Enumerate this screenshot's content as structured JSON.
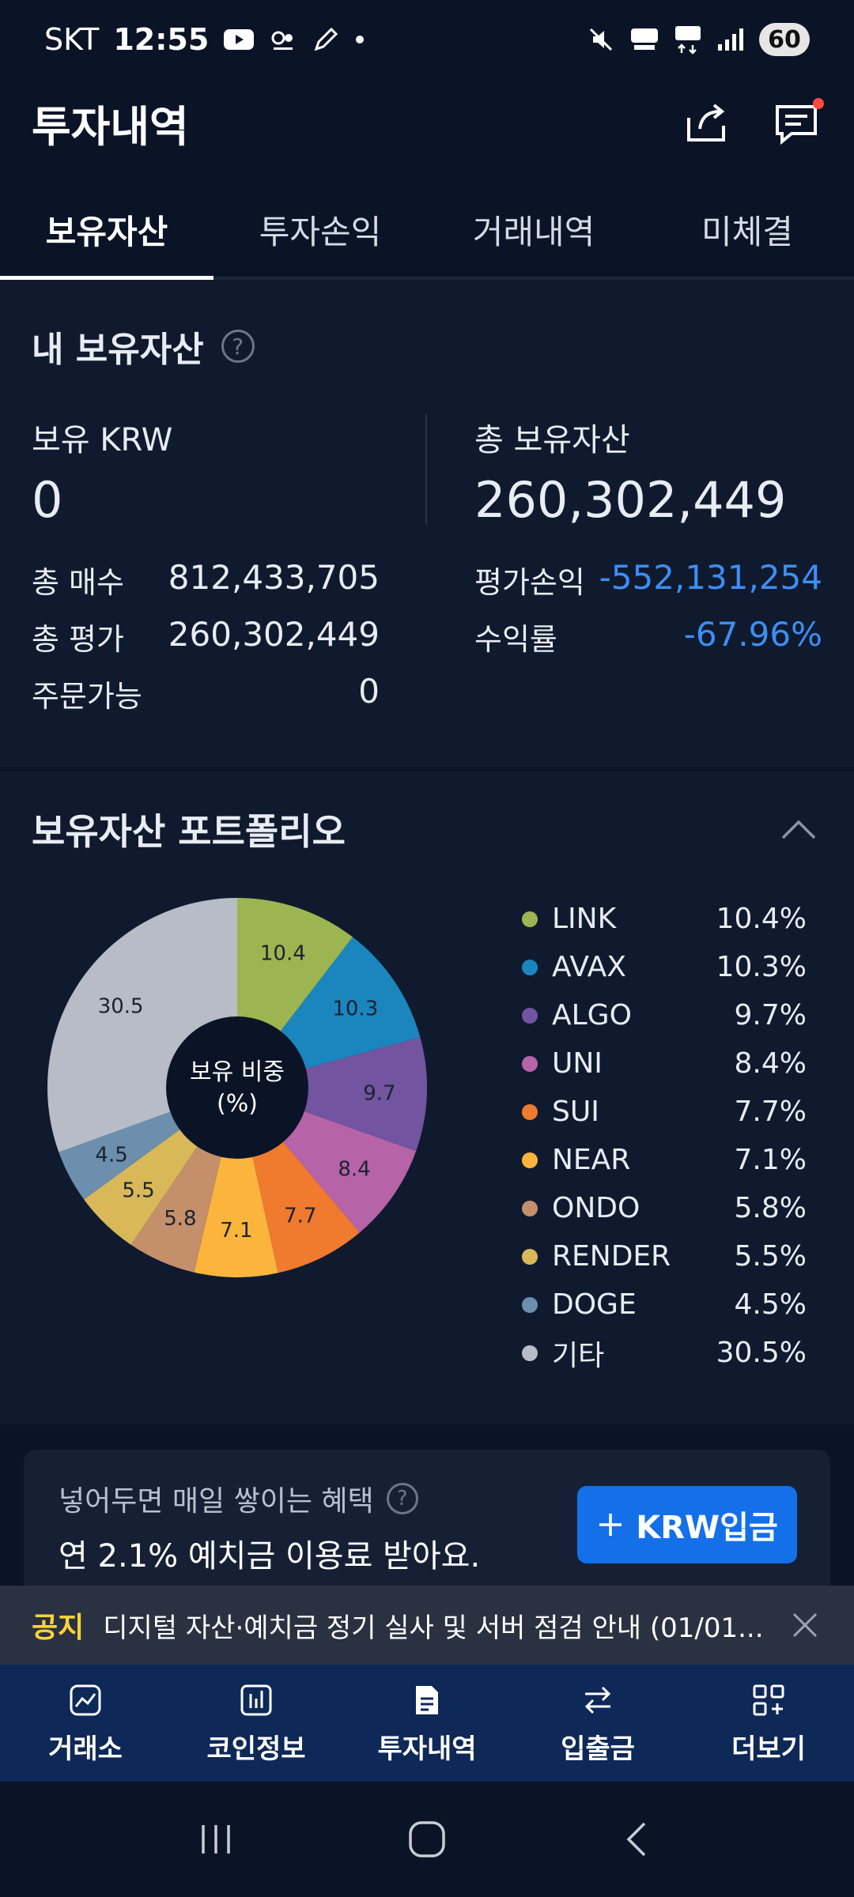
{
  "status_bar": {
    "carrier": "SKT",
    "time": "12:55",
    "battery": "60"
  },
  "header": {
    "title": "투자내역"
  },
  "tabs": [
    {
      "label": "보유자산",
      "active": true
    },
    {
      "label": "투자손익",
      "active": false
    },
    {
      "label": "거래내역",
      "active": false
    },
    {
      "label": "미체결",
      "active": false
    }
  ],
  "assets": {
    "title": "내 보유자산",
    "krw_label": "보유 KRW",
    "krw_value": "0",
    "total_label": "총 보유자산",
    "total_value": "260,302,449",
    "total_buy_label": "총 매수",
    "total_buy_value": "812,433,705",
    "total_eval_label": "총 평가",
    "total_eval_value": "260,302,449",
    "orderable_label": "주문가능",
    "orderable_value": "0",
    "pnl_label": "평가손익",
    "pnl_value": "-552,131,254",
    "return_label": "수익률",
    "return_value": "-67.96%",
    "negative_color": "#3d8ef5"
  },
  "portfolio": {
    "title": "보유자산 포트폴리오",
    "center_label_line1": "보유 비중",
    "center_label_line2": "(%)"
  },
  "chart_data": {
    "type": "pie",
    "categories": [
      "LINK",
      "AVAX",
      "ALGO",
      "UNI",
      "SUI",
      "NEAR",
      "ONDO",
      "RENDER",
      "DOGE",
      "기타"
    ],
    "values": [
      10.4,
      10.3,
      9.7,
      8.4,
      7.7,
      7.1,
      5.8,
      5.5,
      4.5,
      30.5
    ],
    "value_labels": [
      "10.4",
      "10.3",
      "9.7",
      "8.4",
      "7.7",
      "7.1",
      "5.8",
      "5.5",
      "4.5",
      "30.5"
    ],
    "legend_labels": [
      "10.4%",
      "10.3%",
      "9.7%",
      "8.4%",
      "7.7%",
      "7.1%",
      "5.8%",
      "5.5%",
      "4.5%",
      "30.5%"
    ],
    "colors": [
      "#9cb550",
      "#1b86bd",
      "#7254a0",
      "#b663a8",
      "#f07a2e",
      "#fbb53c",
      "#c48f6a",
      "#d9b85a",
      "#6b8fac",
      "#b7bcc6"
    ],
    "legend_position": "right"
  },
  "promo": {
    "line1": "넣어두면 매일 쌓이는 혜택",
    "line2": "연 2.1% 예치금 이용료 받아요.",
    "button_label": "KRW입금"
  },
  "notice": {
    "tag": "공지",
    "text": "디지털 자산·예치금 정기 실사 및 서버 점검 안내 (01/01..."
  },
  "bottom_nav": [
    {
      "label": "거래소",
      "icon": "chart-icon"
    },
    {
      "label": "코인정보",
      "icon": "bar-chart-icon"
    },
    {
      "label": "투자내역",
      "icon": "document-icon"
    },
    {
      "label": "입출금",
      "icon": "transfer-icon"
    },
    {
      "label": "더보기",
      "icon": "grid-plus-icon"
    }
  ]
}
